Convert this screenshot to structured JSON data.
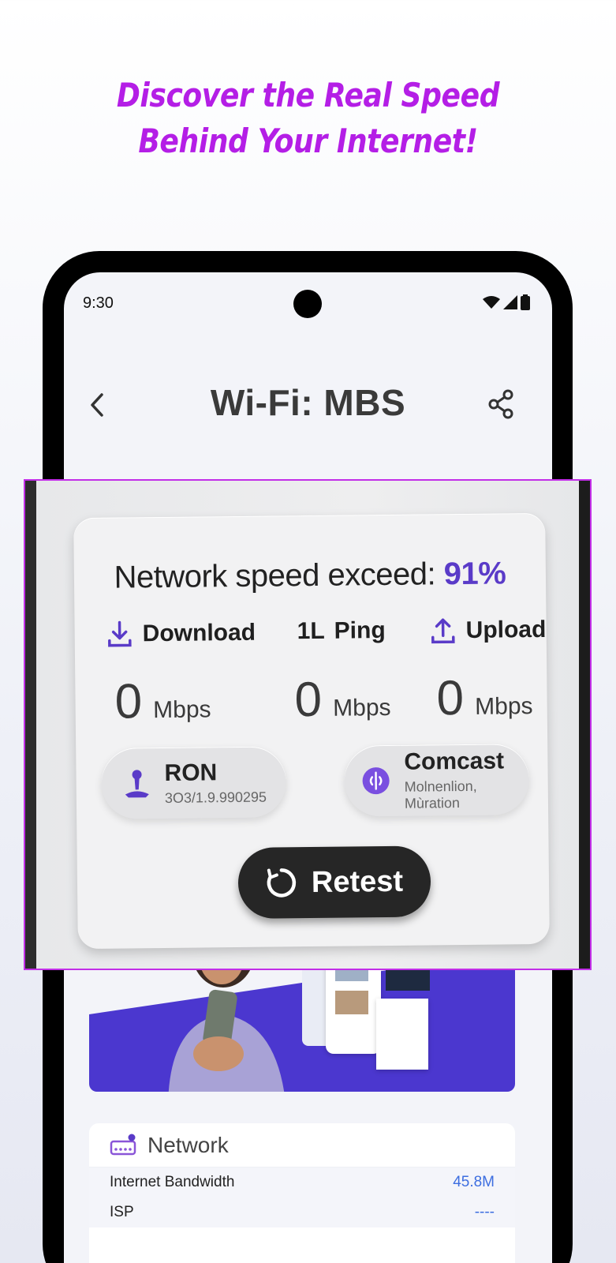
{
  "headline": {
    "line1": "Discover the Real Speed",
    "line2": "Behind Your Internet!"
  },
  "status_bar": {
    "time": "9:30",
    "icons": [
      "wifi-icon",
      "signal-icon",
      "battery-icon"
    ]
  },
  "top_bar": {
    "title": "Wi-Fi: MBS",
    "back_icon": "chevron-left-icon",
    "share_icon": "share-icon"
  },
  "speed_card": {
    "headline_prefix": "Network speed exceed:",
    "headline_value": "91%",
    "metrics": [
      {
        "label": "Download",
        "icon": "download-icon",
        "value": "0",
        "unit": "Mbps"
      },
      {
        "label": "Ping",
        "icon_text": "1L",
        "value": "0",
        "unit": "Mbps"
      },
      {
        "label": "Upload",
        "icon": "upload-icon",
        "value": "0",
        "unit": "Mbps"
      }
    ],
    "device": {
      "name": "RON",
      "detail": "3O3/1.9.990295",
      "icon": "location-pin-icon"
    },
    "provider": {
      "name": "Comcast",
      "detail": "Molnenlion, Mùration",
      "icon": "provider-icon"
    },
    "retest_label": "Retest"
  },
  "network_card": {
    "title": "Network",
    "icon": "router-icon",
    "rows": [
      {
        "label": "Internet Bandwidth",
        "value": "45.8M"
      },
      {
        "label": "ISP",
        "value": "----"
      }
    ]
  },
  "colors": {
    "headline": "#b41ee6",
    "accent": "#5a3bc8",
    "promo_bg": "#4b37cf",
    "value_blue": "#3d6ee0"
  }
}
